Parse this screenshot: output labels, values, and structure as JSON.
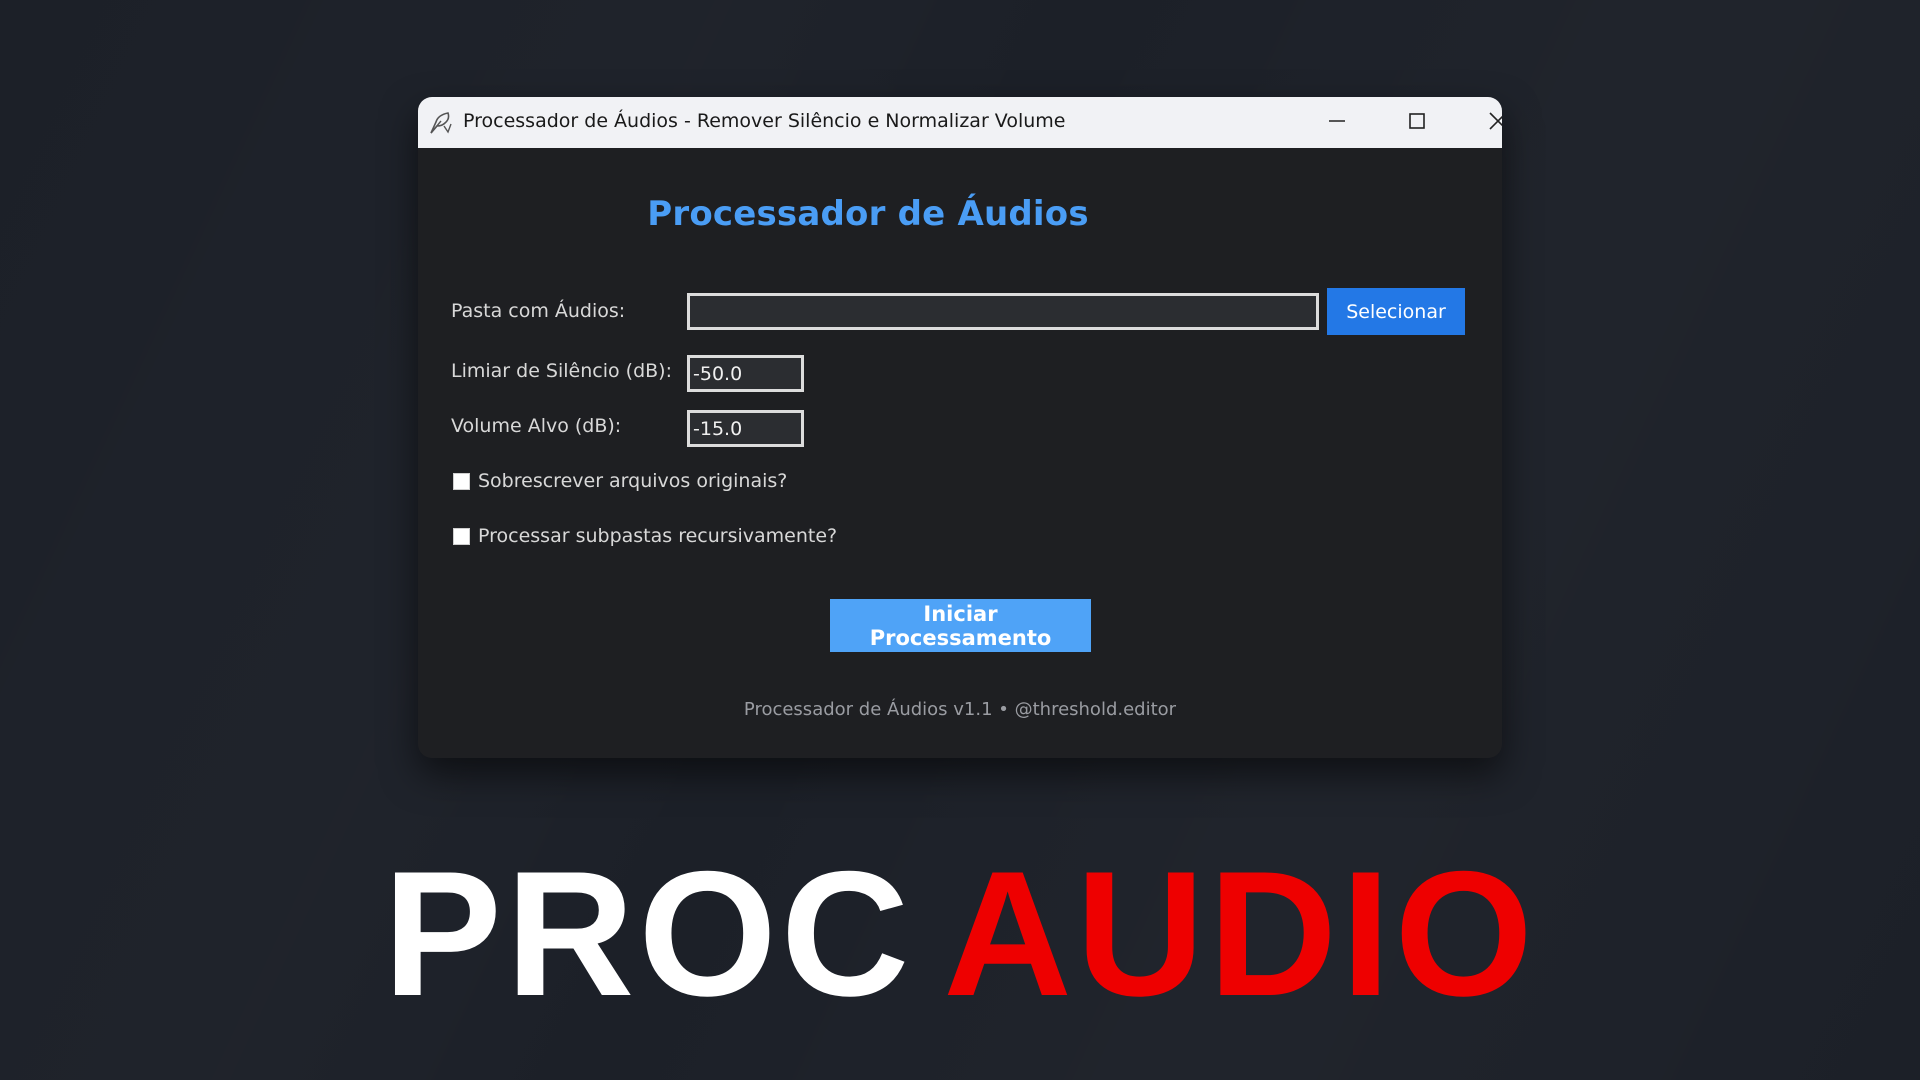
{
  "window": {
    "title": "Processador de Áudios - Remover Silêncio e Normalizar Volume",
    "app_icon": "feather-icon",
    "controls": {
      "minimize": "minimize-icon",
      "maximize": "maximize-icon",
      "close": "close-icon"
    }
  },
  "form": {
    "heading": "Processador de Áudios",
    "folder_label": "Pasta com Áudios:",
    "folder_value": "",
    "select_button": "Selecionar",
    "silence_label": "Limiar de Silêncio (dB):",
    "silence_value": "-50.0",
    "volume_label": "Volume Alvo (dB):",
    "volume_value": "-15.0",
    "overwrite_label": "Sobrescrever arquivos originais?",
    "overwrite_checked": false,
    "recursive_label": "Processar subpastas recursivamente?",
    "recursive_checked": false,
    "start_button": "Iniciar Processamento",
    "footer": "Processador de Áudios v1.1 • @threshold.editor"
  },
  "banner": {
    "word1": "PROC",
    "word2": "AUDIO"
  },
  "colors": {
    "background": "#1c2028",
    "window_body": "#1e1f22",
    "titlebar": "#f1f2f5",
    "heading": "#4a9df5",
    "select_button": "#2378e6",
    "start_button": "#4fa3f7",
    "banner_white": "#ffffff",
    "banner_red": "#ee0000"
  }
}
